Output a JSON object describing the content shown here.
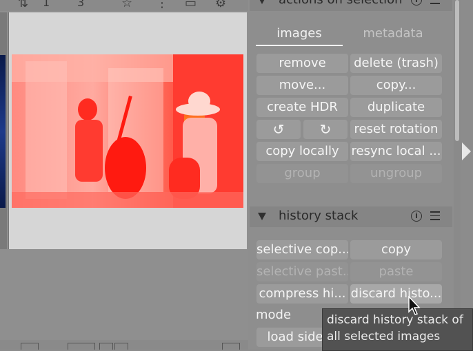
{
  "toolbar": {
    "sort_icon": "sort-icon",
    "zoom_text": "1",
    "count_text": "3",
    "star_icon": "star-icon",
    "more_icon": "more-icon",
    "display_icon": "display-icon",
    "gear_icon": "gear-icon"
  },
  "actions_on_selection": {
    "title": "actions on selection",
    "tabs": [
      "images",
      "metadata"
    ],
    "buttons": {
      "remove": "remove",
      "delete": "delete (trash)",
      "move": "move...",
      "copy": "copy...",
      "create_hdr": "create HDR",
      "duplicate": "duplicate",
      "rotate_ccw": "↺",
      "rotate_cw": "↻",
      "reset_rotation": "reset rotation",
      "copy_locally": "copy locally",
      "resync_local": "resync local ...",
      "group": "group",
      "ungroup": "ungroup"
    }
  },
  "history_stack": {
    "title": "history stack",
    "buttons": {
      "selective_copy": "selective cop...",
      "copy": "copy",
      "selective_paste": "selective past...",
      "paste": "paste",
      "compress_history": "compress hi...",
      "discard_history": "discard histo...",
      "load_sidecar": "load sideca"
    },
    "mode_label": "mode"
  },
  "tooltip": {
    "line1": "discard history stack of",
    "line2": "all selected images"
  },
  "colors": {
    "panel_bg": "#8e8e8e",
    "button_bg": "#9b9b9b",
    "tooltip_bg": "#525252",
    "image_highlight": "#ff3b30"
  }
}
